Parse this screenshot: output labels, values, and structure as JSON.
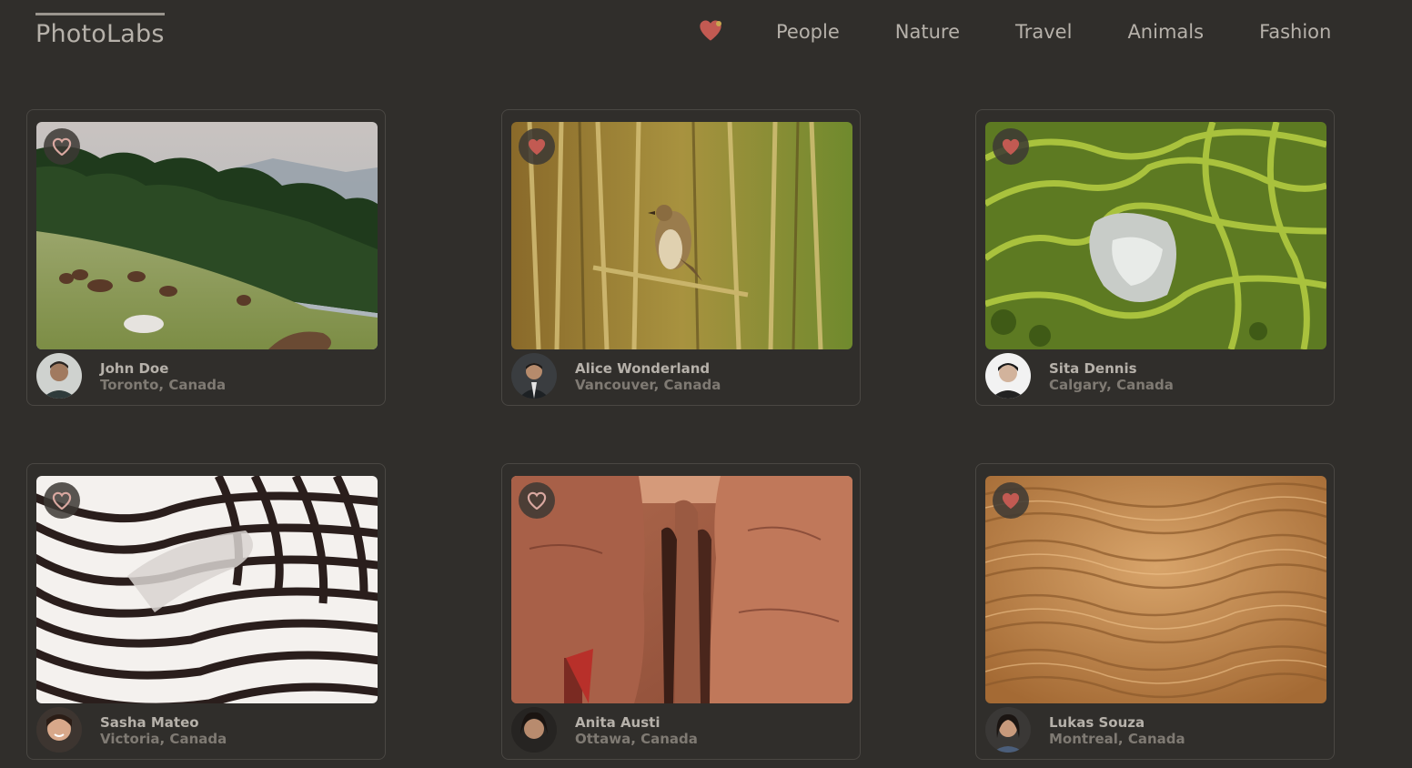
{
  "app": {
    "logo": "PhotoLabs"
  },
  "nav": {
    "favorites_icon": "heart-icon",
    "favorites_has_notification": true,
    "topics": [
      {
        "label": "People"
      },
      {
        "label": "Nature"
      },
      {
        "label": "Travel"
      },
      {
        "label": "Animals"
      },
      {
        "label": "Fashion"
      }
    ]
  },
  "colors": {
    "background": "#302e2b",
    "text": "#b6b1aa",
    "muted_text": "#7f7a73",
    "heart_liked": "#c25a52",
    "heart_unliked": "#d9a8a0",
    "notification_dot": "#c9a44f"
  },
  "photos": [
    {
      "name": "John Doe",
      "location": "Toronto, Canada",
      "liked": false,
      "scene": "horses grazing on a hillside"
    },
    {
      "name": "Alice Wonderland",
      "location": "Vancouver, Canada",
      "liked": true,
      "scene": "bird perched in reeds"
    },
    {
      "name": "Sita Dennis",
      "location": "Calgary, Canada",
      "liked": true,
      "scene": "terraced rice fields"
    },
    {
      "name": "Sasha Mateo",
      "location": "Victoria, Canada",
      "liked": false,
      "scene": "zebra stripes close-up"
    },
    {
      "name": "Anita Austi",
      "location": "Ottawa, Canada",
      "liked": false,
      "scene": "red sandstone canyon"
    },
    {
      "name": "Lukas Souza",
      "location": "Montreal, Canada",
      "liked": true,
      "scene": "desert sand ripples"
    }
  ]
}
